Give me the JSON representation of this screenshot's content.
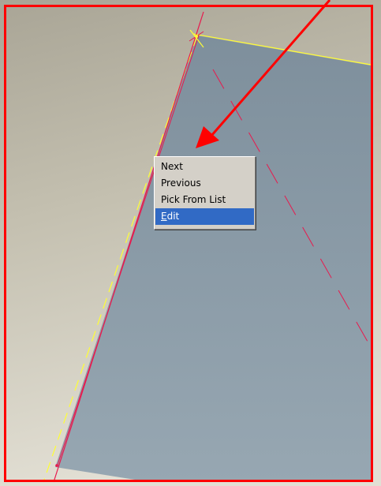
{
  "context_menu": {
    "items": [
      {
        "label": "Next",
        "selected": false
      },
      {
        "label": "Previous",
        "selected": false
      },
      {
        "label": "Pick From List",
        "selected": false
      },
      {
        "label_mnemonic": "E",
        "label_rest": "dit",
        "selected": true
      }
    ]
  },
  "colors": {
    "annotation_red": "#ff0000",
    "edge_yellow": "#ffff33",
    "crimson_line": "#e8194d",
    "surface_blue_gray": "#8a9aa7",
    "background_tan": "#bcb8a8",
    "menu_background": "#d4d0c8",
    "menu_highlight": "#316ac5"
  }
}
